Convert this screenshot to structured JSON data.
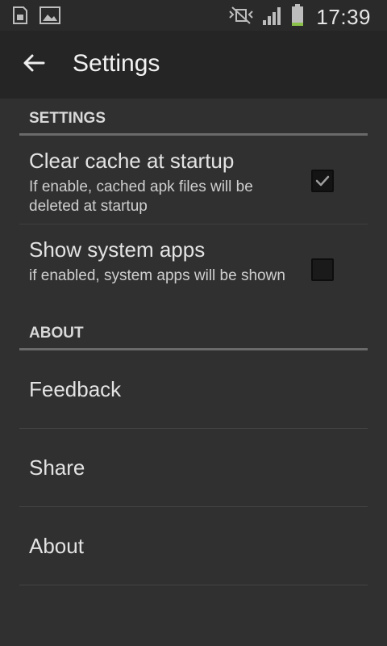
{
  "status_bar": {
    "time": "17:39",
    "icons": [
      "sim-card-icon",
      "image-icon",
      "vibrate-icon",
      "signal-icon",
      "battery-icon"
    ],
    "battery_color": "#8bc34a"
  },
  "action_bar": {
    "title": "Settings",
    "back_icon": "arrow-back-icon"
  },
  "sections": [
    {
      "header": "SETTINGS",
      "items": [
        {
          "title": "Clear cache at startup",
          "summary": "If enable, cached apk files will be deleted at startup",
          "checked": true
        },
        {
          "title": "Show system apps",
          "summary": "if enabled, system apps will be shown",
          "checked": false
        }
      ]
    },
    {
      "header": "ABOUT",
      "items": [
        {
          "title": "Feedback"
        },
        {
          "title": "Share"
        },
        {
          "title": "About"
        }
      ]
    }
  ]
}
